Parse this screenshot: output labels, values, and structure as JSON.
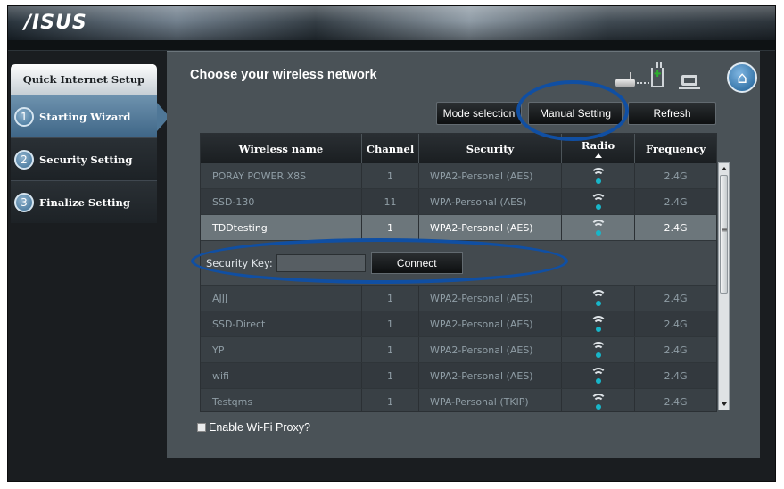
{
  "brand": {
    "logo_text": "/ISUS"
  },
  "sidebar": {
    "title": "Quick Internet Setup",
    "items": [
      {
        "num": "1",
        "label": "Starting Wizard",
        "active": true
      },
      {
        "num": "2",
        "label": "Security Setting",
        "active": false
      },
      {
        "num": "3",
        "label": "Finalize Setting",
        "active": false
      }
    ]
  },
  "main": {
    "title": "Choose your wireless network",
    "home_icon": "home-icon",
    "status_icons": [
      "router-icon",
      "connection-dots-icon",
      "plug-icon",
      "computer-icon"
    ]
  },
  "toolbar": {
    "mode_selection": "Mode selection",
    "manual_setting": "Manual Setting",
    "refresh": "Refresh"
  },
  "table": {
    "headers": [
      "Wireless name",
      "Channel",
      "Security",
      "Radio",
      "Frequency"
    ],
    "sorted_column": "Radio",
    "rows": [
      {
        "name": "PORAY POWER X8S",
        "channel": "1",
        "security": "WPA2-Personal (AES)",
        "frequency": "2.4G"
      },
      {
        "name": "SSD-130",
        "channel": "11",
        "security": "WPA-Personal (AES)",
        "frequency": "2.4G"
      },
      {
        "name": "TDDtesting",
        "channel": "1",
        "security": "WPA2-Personal (AES)",
        "frequency": "2.4G",
        "selected": true
      },
      {
        "name": "AJJJ",
        "channel": "1",
        "security": "WPA2-Personal (AES)",
        "frequency": "2.4G"
      },
      {
        "name": "SSD-Direct",
        "channel": "1",
        "security": "WPA2-Personal (AES)",
        "frequency": "2.4G"
      },
      {
        "name": "YP",
        "channel": "1",
        "security": "WPA2-Personal (AES)",
        "frequency": "2.4G"
      },
      {
        "name": "wifi",
        "channel": "1",
        "security": "WPA2-Personal (AES)",
        "frequency": "2.4G"
      },
      {
        "name": "Testqms",
        "channel": "1",
        "security": "WPA-Personal (TKIP)",
        "frequency": "2.4G"
      }
    ]
  },
  "security_key": {
    "label": "Security Key:",
    "value": "",
    "connect_label": "Connect"
  },
  "proxy": {
    "label": "Enable Wi-Fi Proxy?",
    "checked": false
  },
  "colors": {
    "annotation_circle": "#104fa3",
    "selected_row": "#6c767b",
    "active_step": "#4f7797"
  }
}
